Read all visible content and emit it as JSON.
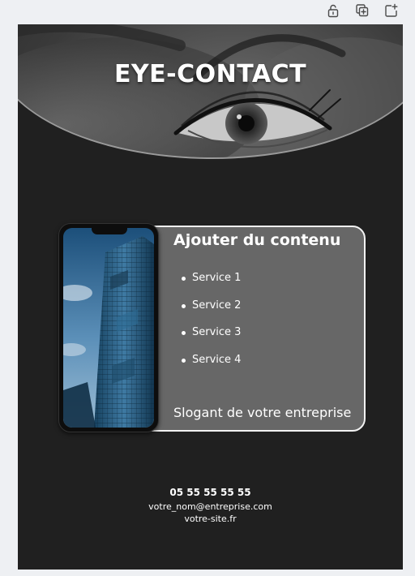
{
  "toolbar": {
    "items": [
      {
        "name": "unlock-icon"
      },
      {
        "name": "duplicate-icon"
      },
      {
        "name": "add-page-icon"
      }
    ]
  },
  "hero": {
    "image": "eye-closeup-photo",
    "headline": "EYE-CONTACT"
  },
  "card": {
    "title": "Ajouter du contenu",
    "services": [
      "Service 1",
      "Service 2",
      "Service 3",
      "Service 4"
    ],
    "slogan": "Slogant de votre entreprise",
    "image": "smartphone-skyscraper-photo"
  },
  "contact": {
    "phone": "05 55 55 55 55",
    "email": "votre_nom@entreprise.com",
    "website": "votre-site.fr"
  },
  "colors": {
    "page_background": "#202020",
    "card_background": "#676767",
    "card_border": "#f2f2f2",
    "text": "#ffffff",
    "canvas_background": "#eef0f3",
    "icon": "#4a4a4a"
  }
}
